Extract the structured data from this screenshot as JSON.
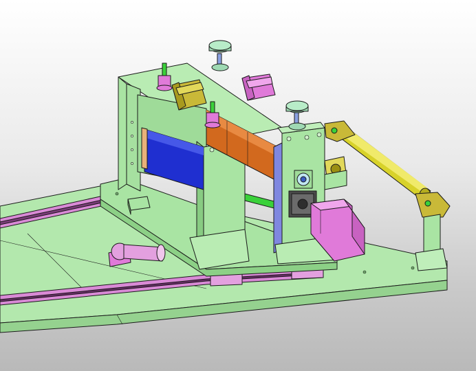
{
  "scene": {
    "kind": "cad-3d-viewport",
    "colors": {
      "background_top": "#ffffff",
      "background_bottom": "#b9b9b9",
      "frame_green": "#a9e4a3",
      "frame_green_dark": "#86c981",
      "rail_magenta": "#d98ad6",
      "roller_blue": "#1f2fd0",
      "roller_orange": "#d2691e",
      "shaft_yellow": "#d8d22a",
      "clamp_olive": "#c9b938",
      "motor_magenta": "#e07ad9",
      "knob_green": "#9fd9b3",
      "edge": "#1a1a1a"
    },
    "components": [
      {
        "name": "base-plate",
        "color": "frame_green"
      },
      {
        "name": "linear-guide-rails",
        "color": "rail_magenta"
      },
      {
        "name": "side-frame-left",
        "color": "frame_green"
      },
      {
        "name": "side-frame-right",
        "color": "frame_green"
      },
      {
        "name": "feed-roller-lower",
        "color": "roller_blue"
      },
      {
        "name": "feed-roller-upper",
        "color": "roller_orange"
      },
      {
        "name": "stepper-motor",
        "color": "motor_magenta"
      },
      {
        "name": "guide-shaft",
        "color": "shaft_yellow"
      },
      {
        "name": "cylinder-clamps",
        "color": "clamp_olive"
      },
      {
        "name": "adjustment-knobs",
        "color": "knob_green"
      },
      {
        "name": "pillow-block-bearing",
        "color": "rail_magenta"
      }
    ]
  }
}
